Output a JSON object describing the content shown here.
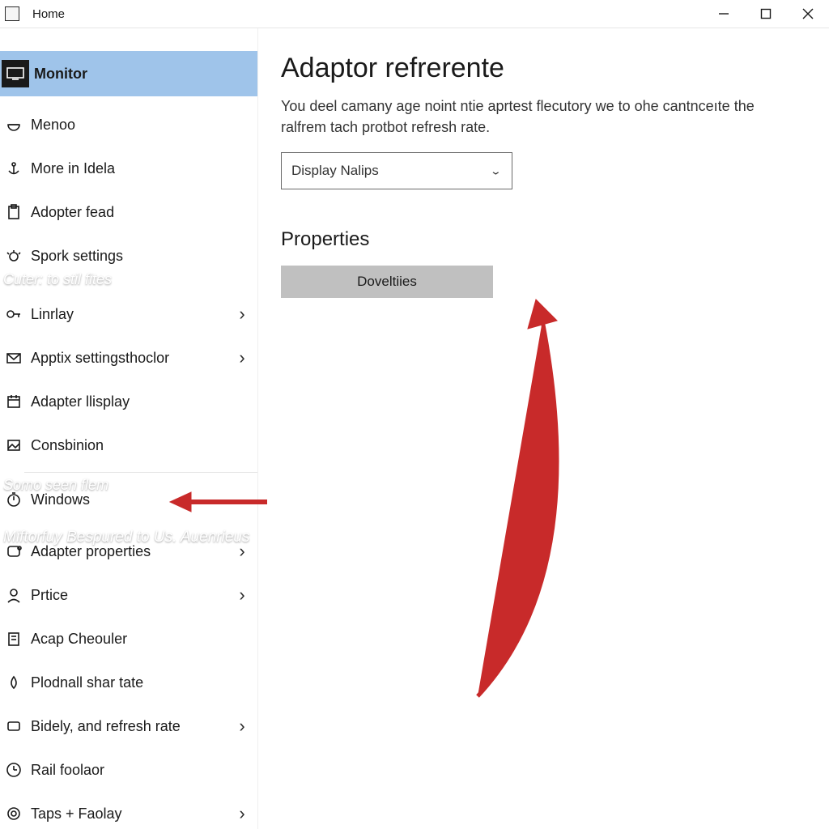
{
  "titlebar": {
    "home": "Home"
  },
  "sidebar": {
    "items": [
      {
        "label": "Monitor"
      },
      {
        "label": "Menoo"
      },
      {
        "label": "More in Idela"
      },
      {
        "label": "Adopter fead"
      },
      {
        "label": "Spork settings"
      },
      {
        "label": "Linrlay"
      },
      {
        "label": "Apptix settingsthoclor"
      },
      {
        "label": "Adapter llisplay"
      },
      {
        "label": "Consbinion"
      },
      {
        "label": "Windows"
      },
      {
        "label": "Adapter properties"
      },
      {
        "label": "Prtice"
      },
      {
        "label": "Acap Cheouler"
      },
      {
        "label": "Plodnall shar tate"
      },
      {
        "label": "Bidely, and refresh rate"
      },
      {
        "label": "Rail foolaor"
      },
      {
        "label": "Taps + Faolay"
      }
    ],
    "overlay1": "Cuter: to stil fites",
    "overlay2": "Somo seen flem",
    "overlay3": "Miftorfuy Bespured to Us. Auenrieus"
  },
  "content": {
    "heading": "Adaptor refrerente",
    "description": "You deel camany age noint ntie aprtest flecutory we to ohe cantnceıte the ralfrem tach protbot refresh rate.",
    "select_value": "Display Nalips",
    "properties_heading": "Properties",
    "button": "Doveltiies"
  }
}
